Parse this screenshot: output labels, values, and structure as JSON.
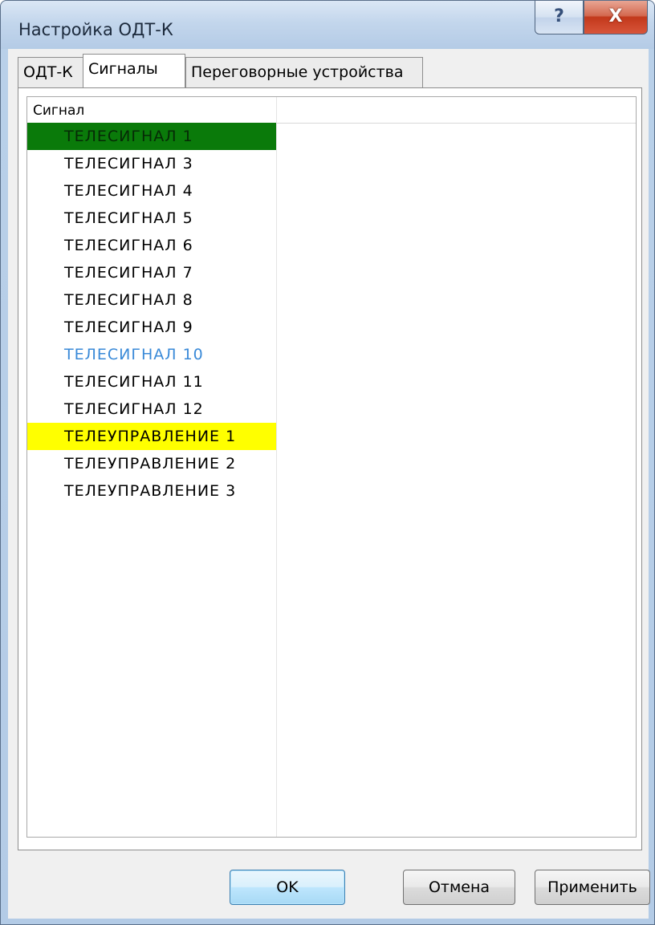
{
  "window": {
    "title": "Настройка ОДТ-К",
    "help_glyph": "?",
    "close_glyph": "X"
  },
  "tabs": [
    {
      "label": "ОДТ-К",
      "active": false
    },
    {
      "label": "Сигналы",
      "active": true
    },
    {
      "label": "Переговорные устройства",
      "active": false
    }
  ],
  "signals": {
    "column_header": "Сигнал",
    "rows": [
      {
        "label": "ТЕЛЕСИГНАЛ  1",
        "highlight": "green",
        "color": "#0a7a0a"
      },
      {
        "label": "ТЕЛЕСИГНАЛ  3",
        "highlight": "none"
      },
      {
        "label": "ТЕЛЕСИГНАЛ  4",
        "highlight": "none"
      },
      {
        "label": "ТЕЛЕСИГНАЛ  5",
        "highlight": "none"
      },
      {
        "label": "ТЕЛЕСИГНАЛ  6",
        "highlight": "none"
      },
      {
        "label": "ТЕЛЕСИГНАЛ  7",
        "highlight": "none"
      },
      {
        "label": "ТЕЛЕСИГНАЛ  8",
        "highlight": "none"
      },
      {
        "label": "ТЕЛЕСИГНАЛ  9",
        "highlight": "none"
      },
      {
        "label": "ТЕЛЕСИГНАЛ  10",
        "highlight": "blue-text",
        "color": "#3a8ad8"
      },
      {
        "label": "ТЕЛЕСИГНАЛ  11",
        "highlight": "none"
      },
      {
        "label": "ТЕЛЕСИГНАЛ  12",
        "highlight": "none"
      },
      {
        "label": "ТЕЛЕУПРАВЛЕНИЕ 1",
        "highlight": "yellow",
        "color": "#ffff00"
      },
      {
        "label": "ТЕЛЕУПРАВЛЕНИЕ 2",
        "highlight": "none"
      },
      {
        "label": "ТЕЛЕУПРАВЛЕНИЕ 3",
        "highlight": "none"
      }
    ]
  },
  "buttons": {
    "ok": "OK",
    "cancel": "Отмена",
    "apply": "Применить"
  }
}
